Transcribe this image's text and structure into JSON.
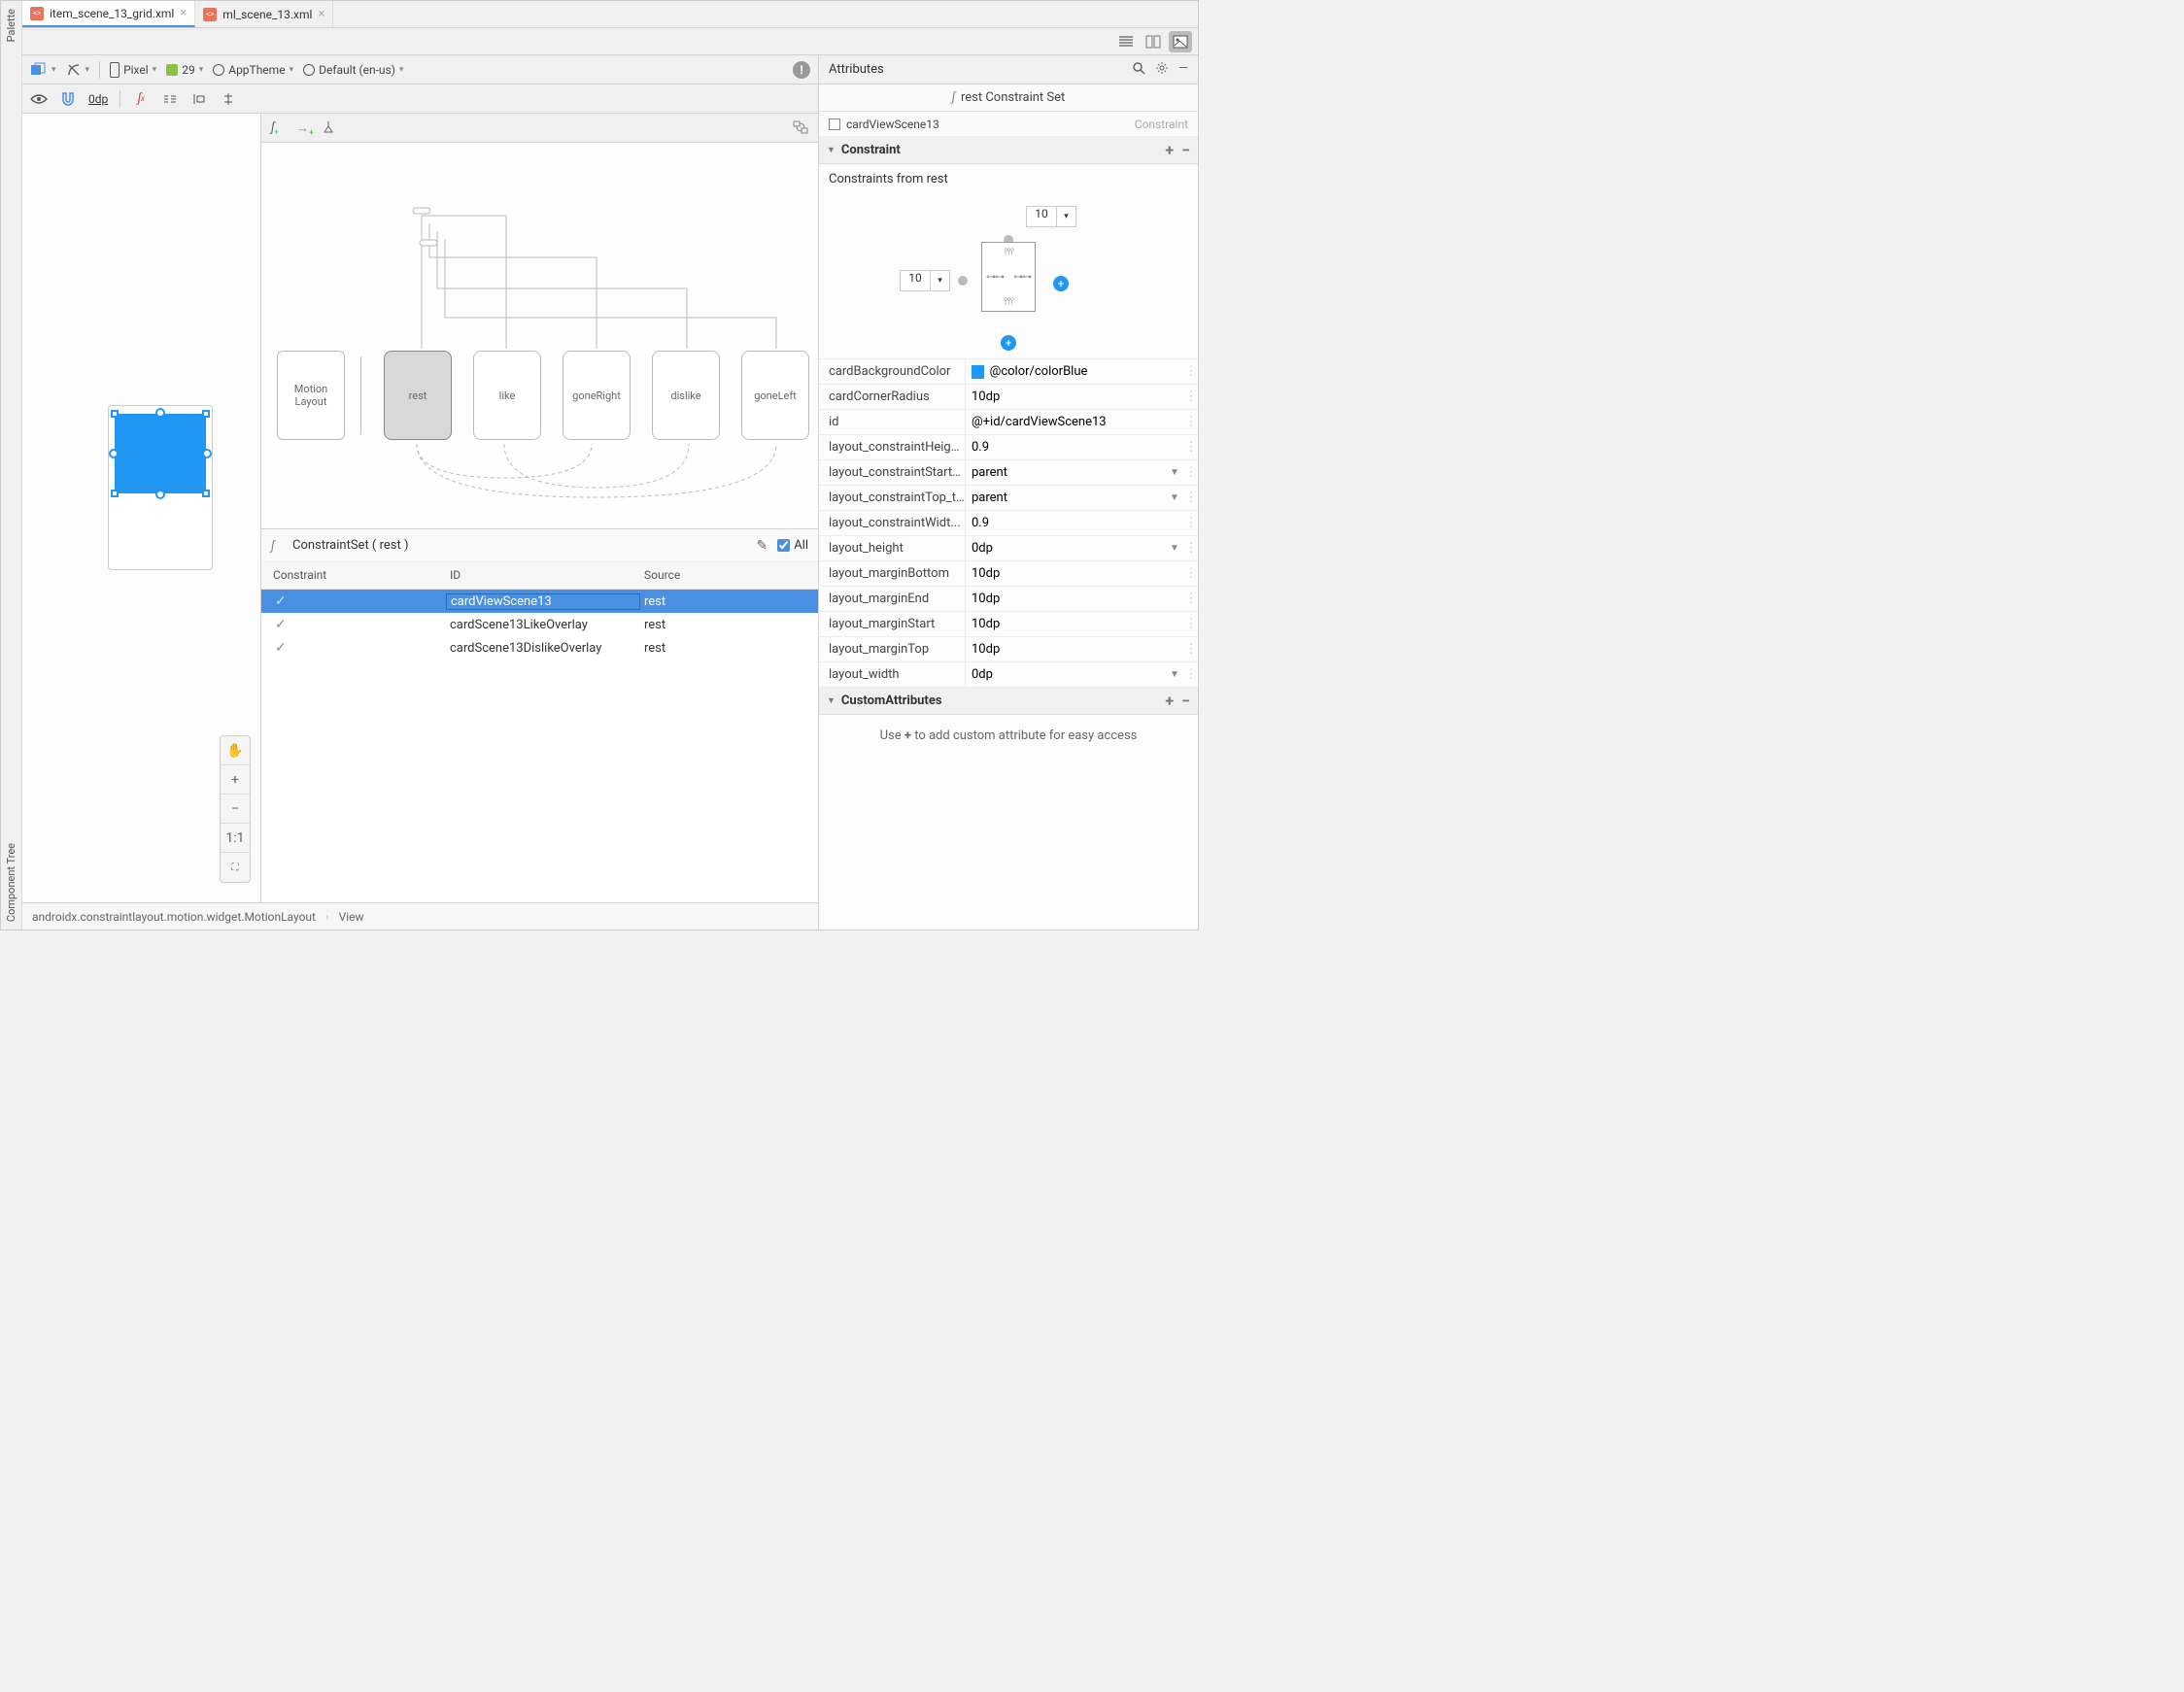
{
  "tabs": [
    {
      "name": "item_scene_13_grid.xml",
      "active": true
    },
    {
      "name": "ml_scene_13.xml",
      "active": false
    }
  ],
  "left_rail": {
    "top": "Palette",
    "bottom": "Component Tree"
  },
  "toolbar1": {
    "device": "Pixel",
    "api": "29",
    "theme": "AppTheme",
    "locale": "Default (en-us)"
  },
  "toolbar2": {
    "dp": "0dp"
  },
  "motion_states": {
    "ml": "Motion\nLayout",
    "rest": "rest",
    "like": "like",
    "goneRight": "goneRight",
    "dislike": "dislike",
    "goneLeft": "goneLeft"
  },
  "constraint_set": {
    "title": "ConstraintSet ( rest )",
    "all_label": "All",
    "headers": {
      "c1": "Constraint",
      "c2": "ID",
      "c3": "Source"
    },
    "rows": [
      {
        "check": "light",
        "id": "cardViewScene13",
        "source": "rest",
        "selected": true
      },
      {
        "check": "dark",
        "id": "cardScene13LikeOverlay",
        "source": "rest",
        "selected": false
      },
      {
        "check": "dark",
        "id": "cardScene13DislikeOverlay",
        "source": "rest",
        "selected": false
      }
    ]
  },
  "attributes": {
    "header": "Attributes",
    "sub": "rest Constraint Set",
    "id_row": {
      "name": "cardViewScene13",
      "tag": "Constraint"
    },
    "section_constraint": "Constraint",
    "constraints_from": "Constraints from rest",
    "widget": {
      "top": "10",
      "left": "10"
    },
    "props": [
      {
        "n": "cardBackgroundColor",
        "v": "@color/colorBlue",
        "swatch": true
      },
      {
        "n": "cardCornerRadius",
        "v": "10dp"
      },
      {
        "n": "id",
        "v": "@+id/cardViewScene13"
      },
      {
        "n": "layout_constraintHeigh...",
        "v": "0.9"
      },
      {
        "n": "layout_constraintStart_...",
        "v": "parent",
        "chev": true
      },
      {
        "n": "layout_constraintTop_t...",
        "v": "parent",
        "chev": true
      },
      {
        "n": "layout_constraintWidt...",
        "v": "0.9"
      },
      {
        "n": "layout_height",
        "v": "0dp",
        "chev": true
      },
      {
        "n": "layout_marginBottom",
        "v": "10dp"
      },
      {
        "n": "layout_marginEnd",
        "v": "10dp"
      },
      {
        "n": "layout_marginStart",
        "v": "10dp"
      },
      {
        "n": "layout_marginTop",
        "v": "10dp"
      },
      {
        "n": "layout_width",
        "v": "0dp",
        "chev": true
      }
    ],
    "section_custom": "CustomAttributes",
    "custom_hint_pre": "Use ",
    "custom_hint_bold": "+",
    "custom_hint_post": " to add custom attribute for easy access"
  },
  "breadcrumb": {
    "p1": "androidx.constraintlayout.motion.widget.MotionLayout",
    "p2": "View"
  },
  "zoom": {
    "pan": "✋",
    "plus": "+",
    "minus": "−",
    "fit": "1:1",
    "expand": "⛶"
  }
}
